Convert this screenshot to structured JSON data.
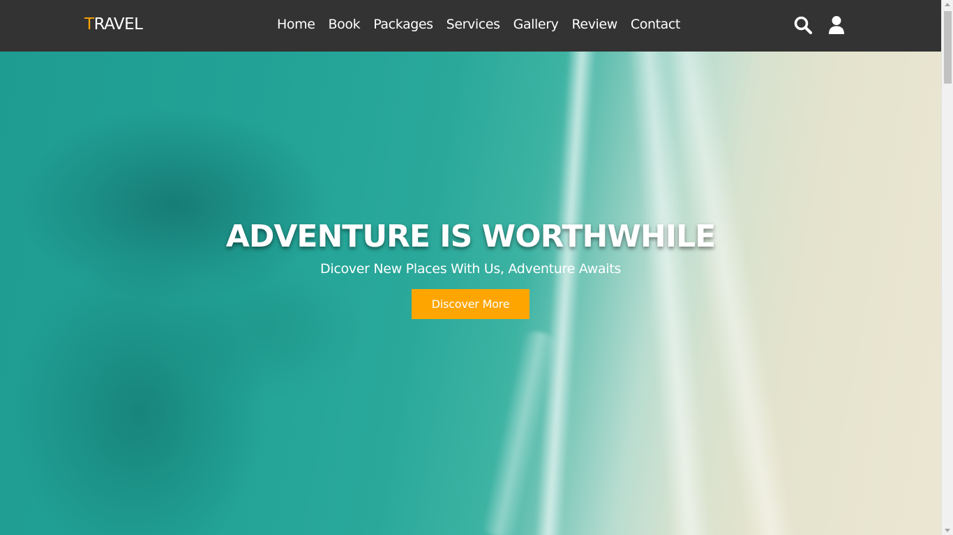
{
  "header": {
    "logo_first_letter": "T",
    "logo_rest": "RAVEL",
    "nav": [
      "Home",
      "Book",
      "Packages",
      "Services",
      "Gallery",
      "Review",
      "Contact"
    ],
    "icons": [
      "search-icon",
      "user-icon"
    ]
  },
  "hero": {
    "title": "ADVENTURE IS WORTHWHILE",
    "subtitle": "Dicover New Places With Us, Adventure Awaits",
    "button_label": "Discover More"
  },
  "colors": {
    "navbar_bg": "#333333",
    "accent": "#ffa500",
    "text": "#ffffff"
  }
}
